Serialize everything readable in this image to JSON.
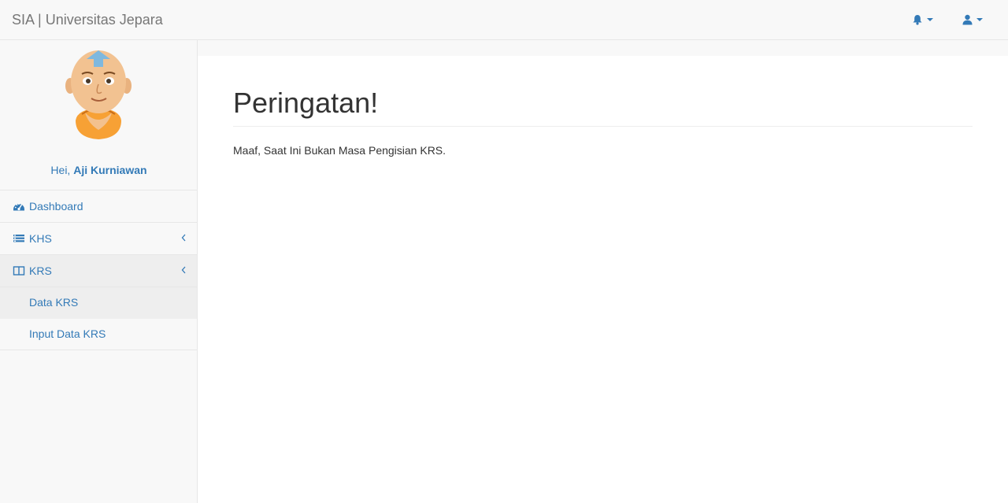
{
  "navbar": {
    "brand": "SIA | Universitas Jepara",
    "notifications_icon": "bell-icon",
    "user_icon": "user-icon"
  },
  "sidebar": {
    "greeting_prefix": "Hei,",
    "user_name": "Aji Kurniawan",
    "avatar": "avatar-cartoon-monk",
    "menu": [
      {
        "label": "Dashboard",
        "icon": "dashboard-icon"
      },
      {
        "label": "KHS",
        "icon": "list-icon"
      },
      {
        "label": "KRS",
        "icon": "columns-icon",
        "children": [
          {
            "label": "Data KRS"
          },
          {
            "label": "Input Data KRS"
          }
        ]
      }
    ]
  },
  "main": {
    "title": "Peringatan!",
    "message": "Maaf, Saat Ini Bukan Masa Pengisian KRS."
  },
  "colors": {
    "link": "#337ab7",
    "navbar_bg": "#f8f8f8",
    "active_bg": "#eeeeee"
  }
}
